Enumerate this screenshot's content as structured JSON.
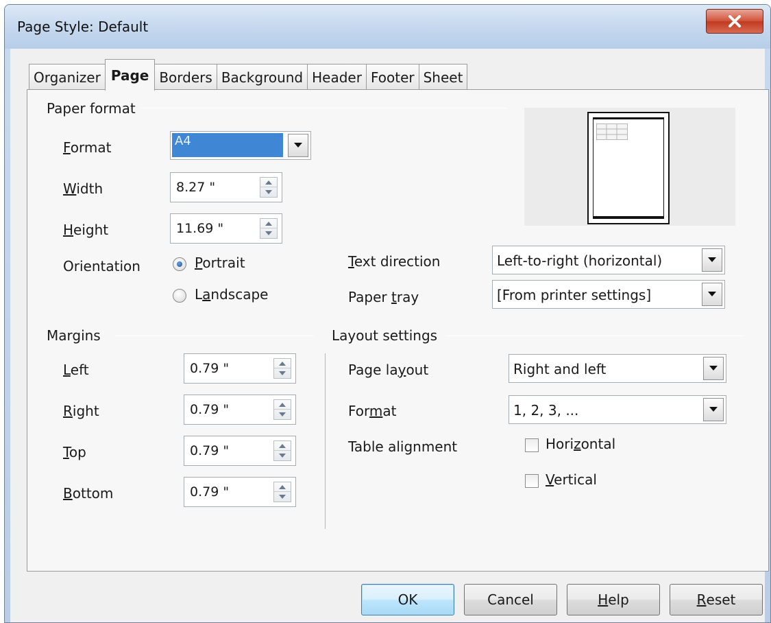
{
  "window": {
    "title": "Page Style: Default"
  },
  "tabs": [
    {
      "label": "Organizer",
      "active": false
    },
    {
      "label": "Page",
      "active": true
    },
    {
      "label": "Borders",
      "active": false
    },
    {
      "label": "Background",
      "active": false
    },
    {
      "label": "Header",
      "active": false
    },
    {
      "label": "Footer",
      "active": false
    },
    {
      "label": "Sheet",
      "active": false
    }
  ],
  "paper_format": {
    "group_label": "Paper format",
    "format": {
      "label_mn": "F",
      "label_rest": "ormat",
      "value": "A4"
    },
    "width": {
      "label_mn": "W",
      "label_rest": "idth",
      "value": "8.27 \""
    },
    "height": {
      "label_mn": "H",
      "label_rest": "eight",
      "value": "11.69 \""
    },
    "orientation": {
      "label": "Orientation",
      "portrait": {
        "label_mn": "P",
        "label_rest": "ortrait",
        "selected": true
      },
      "landscape": {
        "label_pre": "L",
        "label_mn": "a",
        "label_rest": "ndscape",
        "selected": false
      }
    },
    "text_direction": {
      "label_mn": "T",
      "label_rest": "ext direction",
      "value": "Left-to-right (horizontal)"
    },
    "paper_tray": {
      "label_pre": "Paper ",
      "label_mn": "t",
      "label_rest": "ray",
      "value": "[From printer settings]"
    }
  },
  "margins": {
    "group_label": "Margins",
    "left": {
      "label_mn": "L",
      "label_rest": "eft",
      "value": "0.79 \""
    },
    "right": {
      "label_mn": "R",
      "label_rest": "ight",
      "value": "0.79 \""
    },
    "top": {
      "label_mn": "T",
      "label_rest": "op",
      "value": "0.79 \""
    },
    "bottom": {
      "label_mn": "B",
      "label_rest": "ottom",
      "value": "0.79 \""
    }
  },
  "layout_settings": {
    "group_label": "Layout settings",
    "page_layout": {
      "label_pre": "Page la",
      "label_mn": "y",
      "label_rest": "out",
      "value": "Right and left"
    },
    "format": {
      "label_pre": "For",
      "label_mn": "m",
      "label_rest": "at",
      "value": "1, 2, 3, ..."
    },
    "table_alignment": {
      "label": "Table alignment",
      "horizontal": {
        "label_pre": "Hori",
        "label_mn": "z",
        "label_rest": "ontal",
        "checked": false
      },
      "vertical": {
        "label_mn": "V",
        "label_rest": "ertical",
        "checked": false
      }
    }
  },
  "buttons": {
    "ok": "OK",
    "cancel": "Cancel",
    "help_mn": "H",
    "help_rest": "elp",
    "reset_mn": "R",
    "reset_rest": "eset"
  },
  "icons": {
    "close": "close-icon",
    "dropdown": "chevron-down-icon",
    "spin": "spin-arrows-icon"
  }
}
